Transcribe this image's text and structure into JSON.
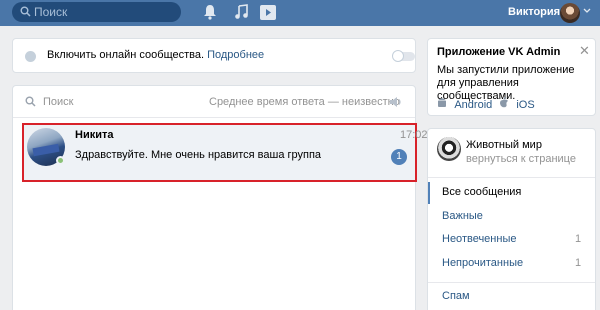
{
  "header": {
    "search_placeholder": "Поиск",
    "user_name": "Виктория"
  },
  "online_banner": {
    "text": "Включить онлайн сообщества.",
    "link": "Подробнее"
  },
  "messages": {
    "search_placeholder": "Поиск",
    "response_time": "Среднее время ответа — неизвестно",
    "dialogs": [
      {
        "name": "Никита",
        "time": "17:02",
        "text": "Здравствуйте. Мне очень нравится ваша группа",
        "unread": "1"
      }
    ]
  },
  "admin_promo": {
    "title": "Приложение VK Admin",
    "description": "Мы запустили приложение для управления сообществами.",
    "android": "Android",
    "ios": "iOS",
    "close": "✕"
  },
  "sidebar": {
    "community_name": "Животный мир",
    "return_link": "вернуться к странице",
    "items": [
      {
        "label": "Все сообщения",
        "count": ""
      },
      {
        "label": "Важные",
        "count": ""
      },
      {
        "label": "Неотвеченные",
        "count": "1"
      },
      {
        "label": "Непрочитанные",
        "count": "1"
      },
      {
        "label": "Спам",
        "count": ""
      }
    ]
  },
  "colors": {
    "header": "#4a76a8",
    "link": "#2a5885",
    "highlight": "#d8222a",
    "badge": "#5181b8"
  }
}
